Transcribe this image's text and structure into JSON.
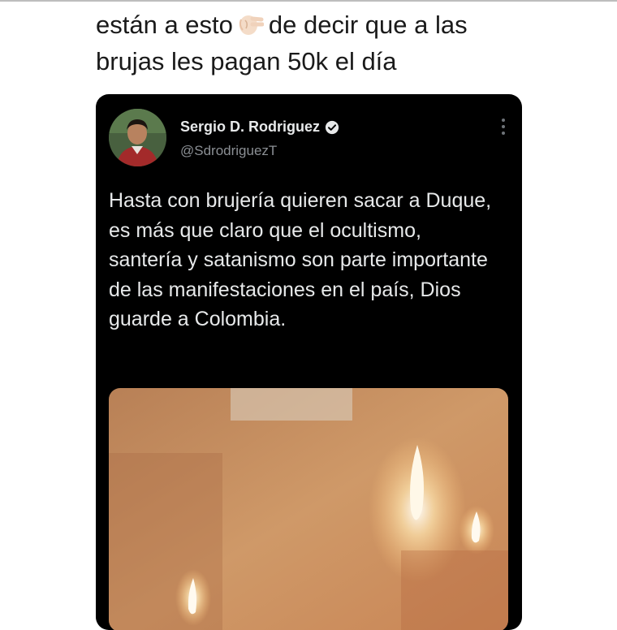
{
  "caption": {
    "line1_before_emoji": "están a esto",
    "emoji_icon": "pinching-hand-icon",
    "line1_after_emoji": "de decir que a las",
    "line2": "brujas les pagan 50k el día"
  },
  "tweet": {
    "author_name": "Sergio D. Rodriguez",
    "handle": "@SdrodriguezT",
    "verified": true,
    "text": "Hasta con brujería quieren sacar a Duque, es más que claro que el ocultismo, santería y satanismo son parte importante de las manifestaciones en el país, Dios guarde a Colombia.",
    "media_description_icon": "candles-photo"
  },
  "colors": {
    "card_bg": "#000000",
    "text_primary": "#e7e9ea",
    "text_secondary": "#8b8f94"
  }
}
